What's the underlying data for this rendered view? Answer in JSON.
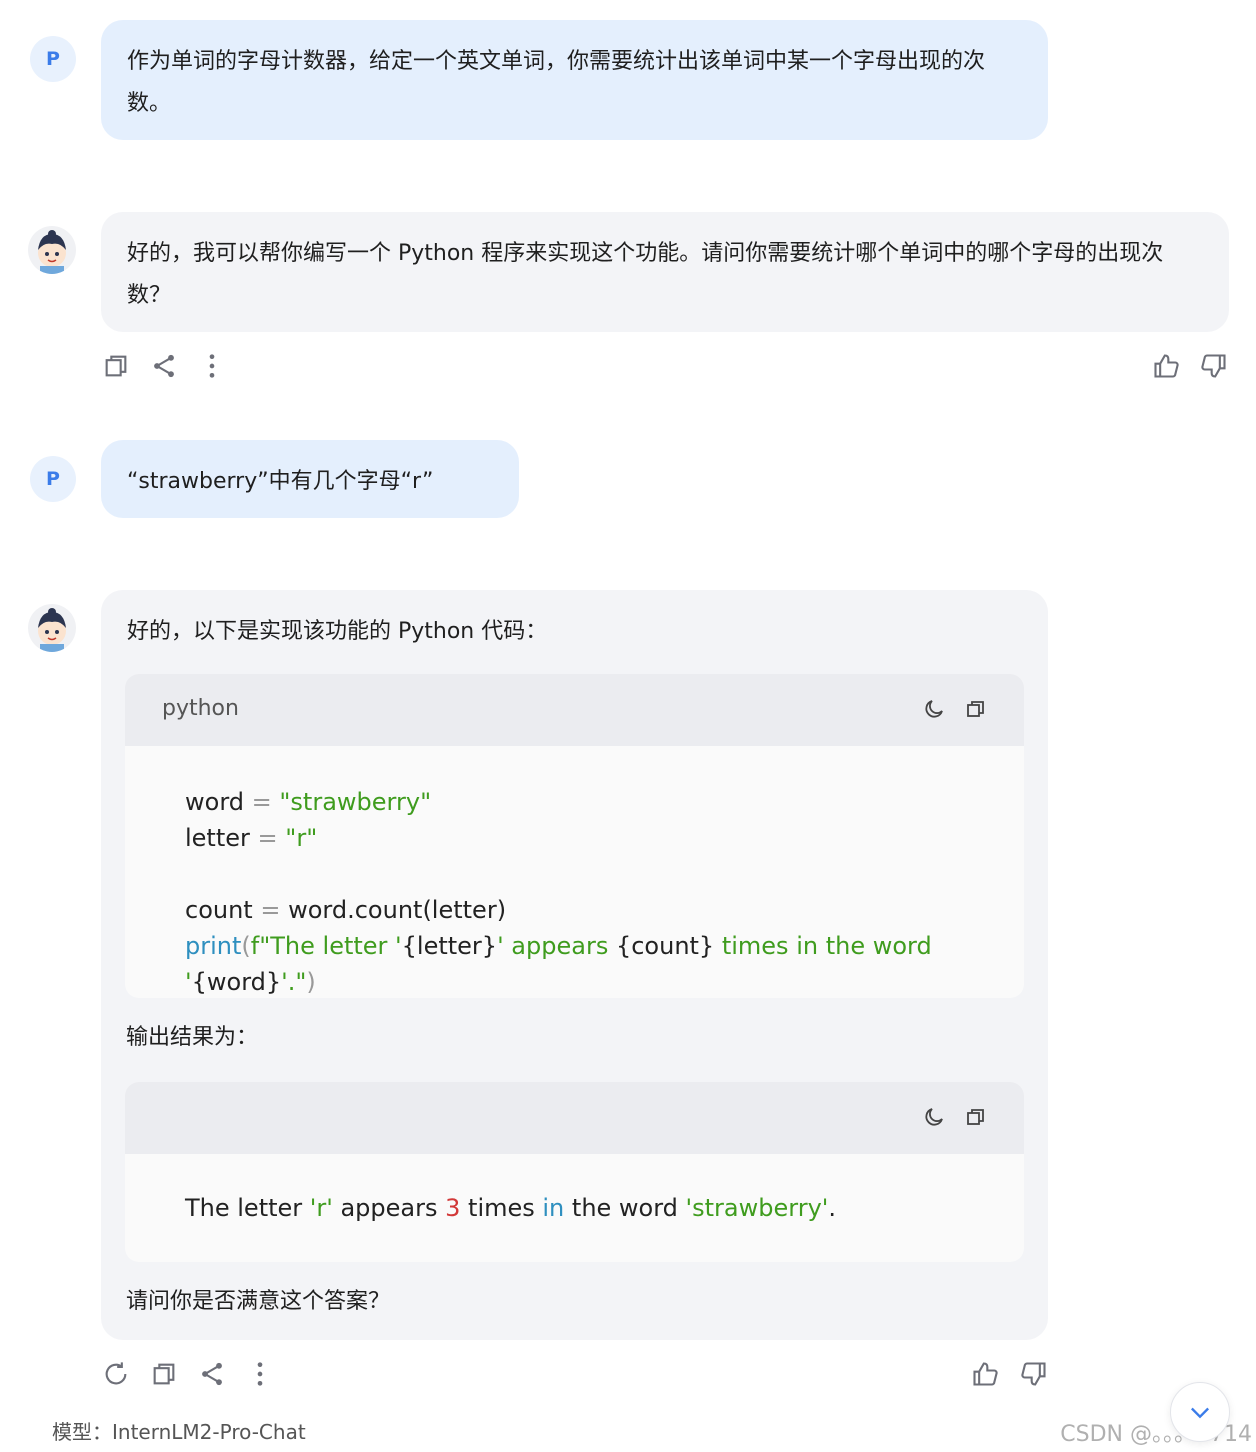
{
  "messages": {
    "m1": {
      "avatar": "P",
      "text": "作为单词的字母计数器，给定一个英文单词，你需要统计出该单词中某一个字母出现的次数。"
    },
    "m2": {
      "text": "好的，我可以帮你编写一个 Python 程序来实现这个功能。请问你需要统计哪个单词中的哪个字母的出现次数？"
    },
    "m3": {
      "avatar": "P",
      "text": "“strawberry”中有几个字母“r”"
    },
    "m4": {
      "intro": "好的，以下是实现该功能的 Python 代码：",
      "code": {
        "lang": "python",
        "line1_var": "word",
        "line1_eq": "=",
        "line1_val": "\"strawberry\"",
        "line2_var": "letter",
        "line2_eq": "=",
        "line2_val": "\"r\"",
        "line3_var": "count",
        "line3_eq": "=",
        "line3_expr": "word.count(letter)",
        "line4_fn": "print",
        "line4_open": "(",
        "line4_f": "f\"The letter '",
        "line4_b1": "{letter}",
        "line4_s2": "' appears ",
        "line4_b2": "{count}",
        "line4_s3": " times in the word '",
        "line4_b3": "{word}",
        "line4_s4": "'.\"",
        "line4_close": ")"
      },
      "output_label": "输出结果为：",
      "output": {
        "t1": "The letter ",
        "t2": "'r'",
        "t3": " appears ",
        "t4": "3",
        "t5": " times ",
        "t6": "in",
        "t7": " the word ",
        "t8": "'strawberry'",
        "t9": "."
      },
      "closing": "请问你是否满意这个答案？"
    }
  },
  "icons": {
    "copy": "copy-icon",
    "share": "share-icon",
    "more": "more-vertical-icon",
    "like": "thumbs-up-icon",
    "dislike": "thumbs-down-icon",
    "regenerate": "refresh-icon",
    "theme": "moon-icon",
    "scroll": "chevron-down-icon"
  },
  "footer": {
    "model": "模型：InternLM2-Pro-Chat",
    "watermark": "CSDN @。。。0714"
  },
  "colors": {
    "accent": "#3b7ce9",
    "user_bubble": "#e4effd",
    "bot_bubble": "#f3f4f7",
    "string": "#3f9c1e",
    "number": "#d23838",
    "keyword": "#2e8fbf"
  }
}
